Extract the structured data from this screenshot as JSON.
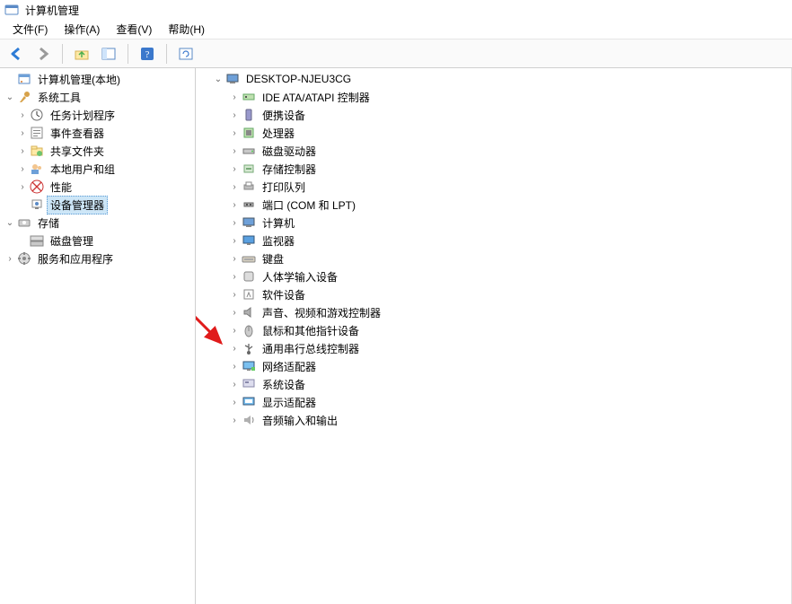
{
  "window": {
    "title": "计算机管理"
  },
  "menu": {
    "file": "文件(F)",
    "action": "操作(A)",
    "view": "查看(V)",
    "help": "帮助(H)"
  },
  "toolbar": {
    "back": "后退",
    "forward": "前进",
    "up": "上一级",
    "show_hide": "显示/隐藏控制台树",
    "help": "帮助",
    "refresh": "刷新"
  },
  "left_tree": {
    "root": "计算机管理(本地)",
    "system_tools": {
      "label": "系统工具",
      "children": {
        "task_scheduler": "任务计划程序",
        "event_viewer": "事件查看器",
        "shared_folders": "共享文件夹",
        "local_users": "本地用户和组",
        "performance": "性能",
        "device_manager": "设备管理器"
      }
    },
    "storage": {
      "label": "存储",
      "children": {
        "disk_mgmt": "磁盘管理"
      }
    },
    "services_apps": "服务和应用程序"
  },
  "right_tree": {
    "root": "DESKTOP-NJEU3CG",
    "categories": {
      "ide": "IDE ATA/ATAPI 控制器",
      "portable": "便携设备",
      "processors": "处理器",
      "disk_drives": "磁盘驱动器",
      "storage_ctrl": "存储控制器",
      "print_queues": "打印队列",
      "ports": "端口 (COM 和 LPT)",
      "computer": "计算机",
      "monitors": "监视器",
      "keyboards": "键盘",
      "hid": "人体学输入设备",
      "software": "软件设备",
      "sound": "声音、视频和游戏控制器",
      "mice": "鼠标和其他指针设备",
      "usb": "通用串行总线控制器",
      "network": "网络适配器",
      "system": "系统设备",
      "display": "显示适配器",
      "audio_io": "音频输入和输出"
    }
  }
}
